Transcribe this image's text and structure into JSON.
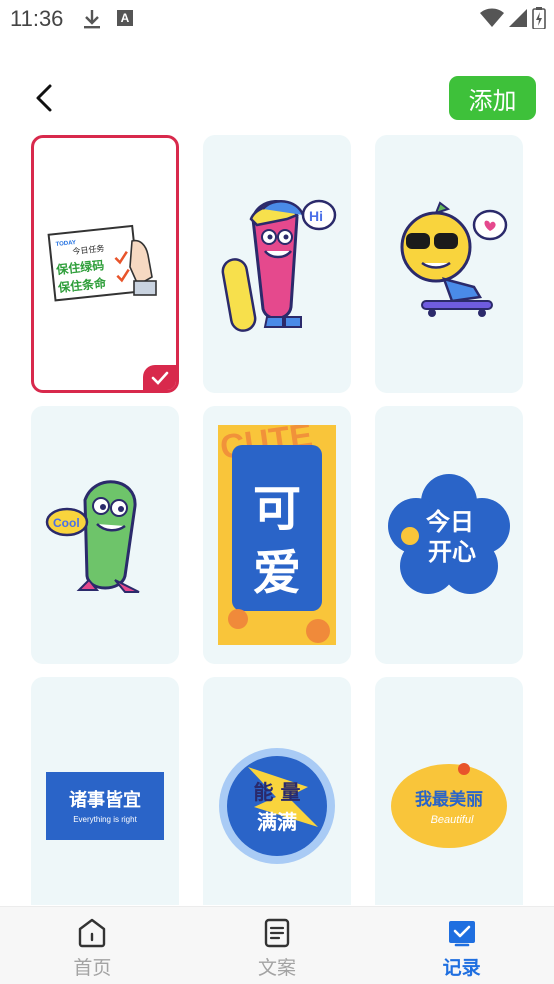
{
  "status": {
    "time": "11:36",
    "a_icon": "A"
  },
  "header": {
    "add_label": "添加"
  },
  "stickers": {
    "s1": {
      "today": "TODAY",
      "task": "今日任务",
      "line1": "保住绿码",
      "line2": "保住条命"
    },
    "s2": {
      "hi": "Hi"
    },
    "s4": {
      "cool": "Cool"
    },
    "s5": {
      "cute": "CUTE",
      "c1": "可",
      "c2": "爱"
    },
    "s6": {
      "t1": "今日",
      "t2": "开心"
    },
    "s7": {
      "cn": "诸事皆宜",
      "en": "Everything is right"
    },
    "s8": {
      "t1": "能 量",
      "t2": "满满"
    },
    "s9": {
      "cn": "我最美丽",
      "en": "Beautiful"
    }
  },
  "tabs": [
    {
      "label": "首页",
      "icon": "home-icon"
    },
    {
      "label": "文案",
      "icon": "document-icon"
    },
    {
      "label": "记录",
      "icon": "record-icon"
    }
  ],
  "colors": {
    "accent": "#1f6fe0",
    "add_button": "#3ec13a",
    "selected_border": "#d8294c",
    "card_bg": "#eef7f9"
  }
}
